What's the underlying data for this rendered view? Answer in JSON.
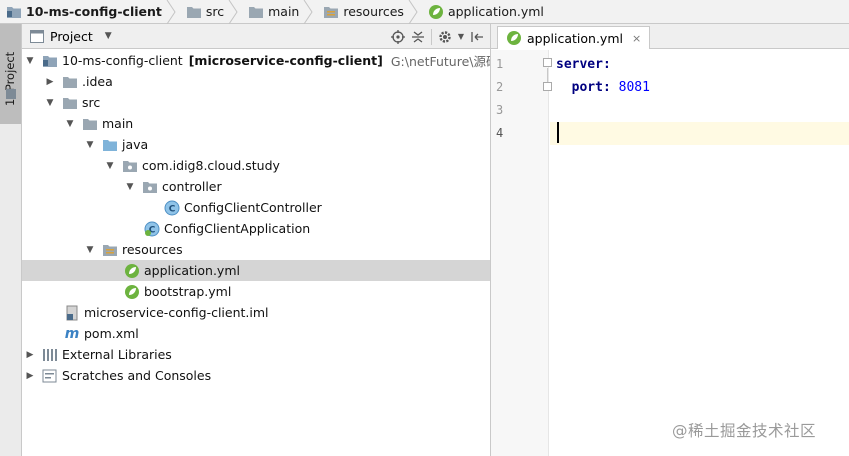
{
  "breadcrumb": [
    {
      "label": "10-ms-config-client",
      "icon": "module-folder-icon",
      "bold": true
    },
    {
      "label": "src",
      "icon": "folder-icon"
    },
    {
      "label": "main",
      "icon": "folder-icon"
    },
    {
      "label": "resources",
      "icon": "resources-folder-icon"
    },
    {
      "label": "application.yml",
      "icon": "spring-leaf-icon"
    }
  ],
  "stripe": {
    "tab_label": "1: Project"
  },
  "project_panel": {
    "title": "Project",
    "tools": [
      "locate-icon",
      "collapse-all-icon",
      "settings-icon",
      "hide-icon"
    ]
  },
  "tree": [
    {
      "arrow": "down",
      "icon": "module-folder-icon",
      "label": "10-ms-config-client",
      "bold_suffix": "[microservice-config-client]",
      "path": "G:\\netFuture\\源码\\『互联"
    },
    {
      "arrow": "right",
      "icon": "folder-icon",
      "label": ".idea"
    },
    {
      "arrow": "down",
      "icon": "folder-icon",
      "label": "src"
    },
    {
      "arrow": "down",
      "icon": "folder-icon",
      "label": "main"
    },
    {
      "arrow": "down",
      "icon": "source-folder-icon",
      "label": "java"
    },
    {
      "arrow": "down",
      "icon": "package-icon",
      "label": "com.idig8.cloud.study"
    },
    {
      "arrow": "down",
      "icon": "package-icon",
      "label": "controller"
    },
    {
      "arrow": "none",
      "icon": "class-icon",
      "label": "ConfigClientController"
    },
    {
      "arrow": "none",
      "icon": "spring-class-icon",
      "label": "ConfigClientApplication"
    },
    {
      "arrow": "down",
      "icon": "resources-folder-icon",
      "label": "resources"
    },
    {
      "arrow": "none",
      "icon": "spring-leaf-icon",
      "label": "application.yml",
      "selected": true
    },
    {
      "arrow": "none",
      "icon": "spring-leaf-icon",
      "label": "bootstrap.yml"
    },
    {
      "arrow": "none",
      "icon": "iml-file-icon",
      "label": "microservice-config-client.iml"
    },
    {
      "arrow": "none",
      "icon": "maven-icon",
      "label": "pom.xml"
    },
    {
      "arrow": "right",
      "icon": "libraries-icon",
      "label": "External Libraries"
    },
    {
      "arrow": "right",
      "icon": "scratches-icon",
      "label": "Scratches and Consoles"
    }
  ],
  "editor": {
    "tab": {
      "label": "application.yml",
      "close": "×"
    },
    "lines": [
      {
        "num": "1",
        "key": "server:",
        "value": ""
      },
      {
        "num": "2",
        "key": "  port:",
        "value": " 8081"
      },
      {
        "num": "3",
        "key": "",
        "value": ""
      },
      {
        "num": "4",
        "key": "",
        "value": ""
      }
    ]
  },
  "watermark": "@稀土掘金技术社区",
  "colors": {
    "key": "#000080",
    "number": "#0000ff",
    "selection": "#d5d5d5",
    "current_line": "#fffae3"
  }
}
